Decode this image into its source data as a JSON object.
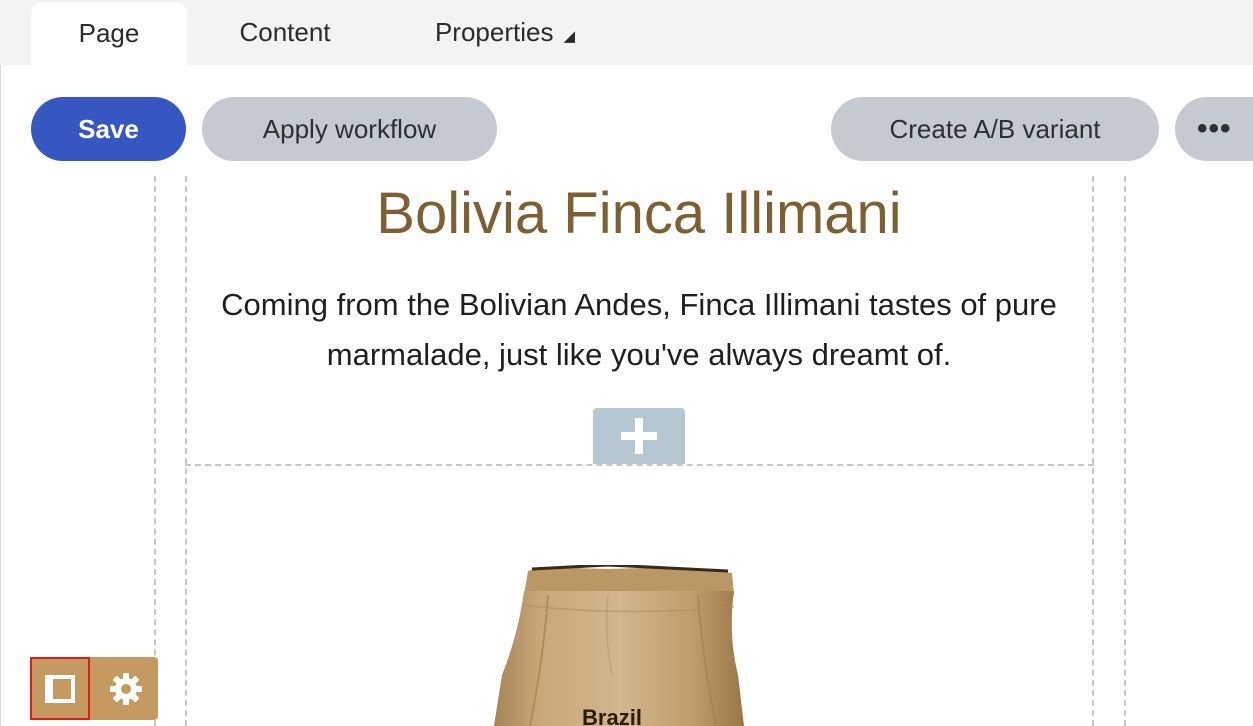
{
  "tabs": [
    {
      "label": "Page",
      "active": true
    },
    {
      "label": "Content",
      "active": false
    },
    {
      "label": "Properties",
      "active": false,
      "has_dropdown": true
    }
  ],
  "toolbar": {
    "save_label": "Save",
    "apply_workflow_label": "Apply workflow",
    "ab_variant_label": "Create A/B variant",
    "more_label": "•••"
  },
  "content": {
    "title": "Bolivia Finca Illimani",
    "description": "Coming from the Bolivian Andes, Finca Illimani tastes of pure marmalade, just like you've always dreamt of.",
    "bag_label": "Brazil"
  },
  "tools": {
    "layout_icon": "sidebar-layout-icon",
    "settings_icon": "gear-icon"
  },
  "colors": {
    "primary": "#3657c2",
    "secondary": "#c5c9d1",
    "title": "#7d5f32",
    "tool_bg": "#c49a61",
    "add_block": "#b5c7d1",
    "highlight": "#e01b1b"
  }
}
